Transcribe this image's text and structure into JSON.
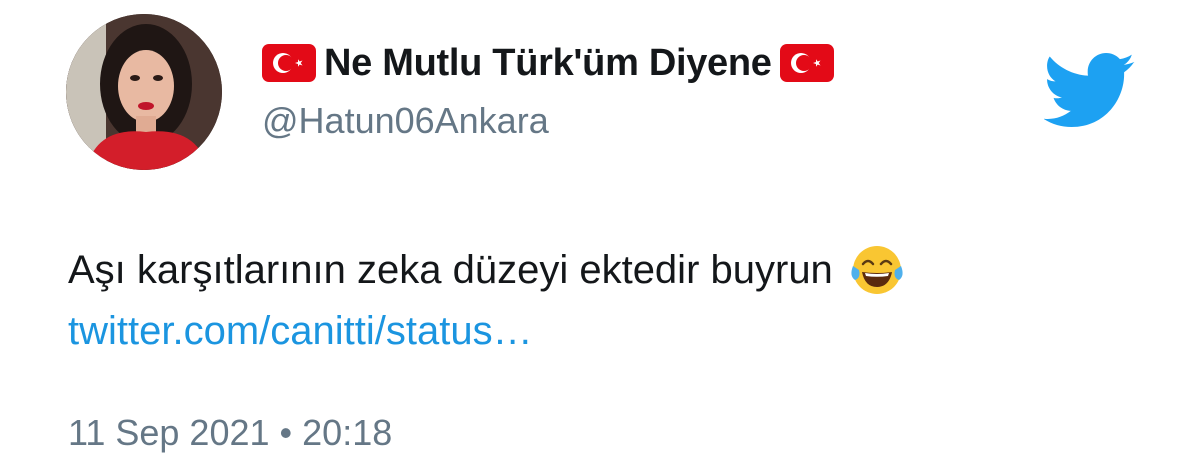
{
  "user": {
    "display_name": "Ne Mutlu Türk'üm Diyene",
    "handle": "@Hatun06Ankara",
    "name_prefix_icon": "turkish-flag-icon",
    "name_suffix_icon": "turkish-flag-icon"
  },
  "tweet": {
    "text": "Aşı karşıtlarının zeka düzeyi ektedir buyrun",
    "emoji_icon": "tears-of-joy-emoji-icon",
    "link_text": "twitter.com/canitti/status…",
    "date": "11 Sep 2021",
    "separator": "•",
    "time": "20:18"
  },
  "brand": {
    "icon": "twitter-bird-icon",
    "color": "#1da1f2"
  },
  "colors": {
    "text": "#14171a",
    "secondary": "#657786",
    "link": "#1b95e0",
    "flag_red": "#e30a17"
  }
}
